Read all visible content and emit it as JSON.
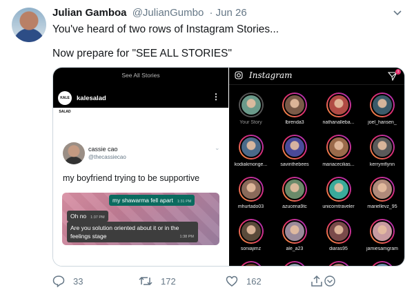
{
  "tweet": {
    "name": "Julian Gamboa",
    "handle": "@JulianGumbo",
    "date": "· Jun 26",
    "line1": "You've heard of two rows of Instagram Stories...",
    "line2": "Now prepare for \"SEE ALL STORIES\""
  },
  "left_panel": {
    "title": "See All Stories",
    "account_logo_text": "KALE SALAD",
    "account_name": "kalesalad",
    "embedded_tweet": {
      "name": "cassie cao",
      "handle": "@thecassiecao",
      "text": "my boyfriend trying to be supportive"
    },
    "chat": [
      {
        "text": "my shawarma fell apart",
        "time": "1:31 PM"
      },
      {
        "text": "Oh no",
        "time": "1:37 PM"
      },
      {
        "text": "Are you solution oriented about it or in the feelings stage",
        "time": "1:38 PM"
      }
    ]
  },
  "right_panel": {
    "app_title": "Instagram",
    "badge_count": "1",
    "stories": [
      {
        "label": "Your Story",
        "seen": true,
        "color": "#6a9a8a"
      },
      {
        "label": "lbrenda3",
        "seen": false,
        "color": "#7a5a48"
      },
      {
        "label": "nathanalleba...",
        "seen": false,
        "color": "#b04a44"
      },
      {
        "label": "joel_hansen_",
        "seen": false,
        "color": "#3a5a6a"
      },
      {
        "label": "kodiakmonge...",
        "seen": false,
        "color": "#4a6a8a"
      },
      {
        "label": "savinthebees",
        "seen": false,
        "color": "#4a4a9a"
      },
      {
        "label": "mariacecilias...",
        "seen": false,
        "color": "#9a6a4a"
      },
      {
        "label": "kerrymflynn",
        "seen": false,
        "color": "#5a5a5a"
      },
      {
        "label": "mhurtado03",
        "seen": false,
        "color": "#8a6a5a"
      },
      {
        "label": "azucena9tc",
        "seen": false,
        "color": "#6a8a6a"
      },
      {
        "label": "unicorntraveler",
        "seen": false,
        "color": "#3aaa9a"
      },
      {
        "label": "mariellevz_95",
        "seen": false,
        "color": "#b08a7a"
      },
      {
        "label": "soniajimz",
        "seen": false,
        "color": "#5a4a3a"
      },
      {
        "label": "ale_a23",
        "seen": false,
        "color": "#9a8a9a"
      },
      {
        "label": "diaras95",
        "seen": false,
        "color": "#7a4a4a"
      },
      {
        "label": "jamiesamgram",
        "seen": false,
        "color": "#c89aa0"
      },
      {
        "label": "",
        "seen": false,
        "color": "#6a3a2a"
      },
      {
        "label": "",
        "seen": false,
        "color": "#8a9aaa"
      },
      {
        "label": "",
        "seen": false,
        "color": "#aa7a6a"
      },
      {
        "label": "",
        "seen": false,
        "color": "#6a8aaa"
      }
    ]
  },
  "actions": {
    "replies": "33",
    "retweets": "172",
    "likes": "162"
  },
  "icons": [
    "chevron-down-icon",
    "camera-icon",
    "send-icon",
    "reply-icon",
    "retweet-icon",
    "like-icon",
    "share-icon"
  ]
}
